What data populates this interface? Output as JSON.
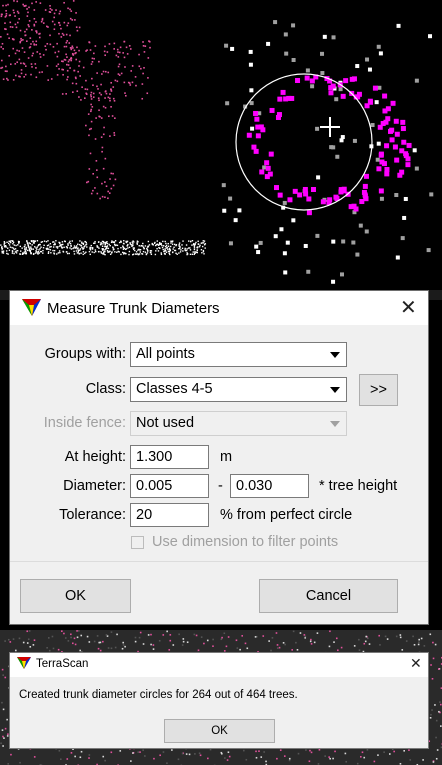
{
  "measure_dialog": {
    "title": "Measure Trunk Diameters",
    "groups_with": {
      "label": "Groups with:",
      "value": "All points"
    },
    "class": {
      "label": "Class:",
      "value": "Classes 4-5",
      "more_button": ">>"
    },
    "inside_fence": {
      "label": "Inside fence:",
      "value": "Not used"
    },
    "at_height": {
      "label": "At height:",
      "value": "1.300",
      "unit": "m"
    },
    "diameter": {
      "label": "Diameter:",
      "min": "0.005",
      "dash": "-",
      "max": "0.030",
      "unit": "* tree height"
    },
    "tolerance": {
      "label": "Tolerance:",
      "value": "20",
      "unit": "% from perfect circle"
    },
    "use_dimension": {
      "label": "Use dimension to filter points",
      "checked": false
    },
    "ok_label": "OK",
    "cancel_label": "Cancel"
  },
  "terrascan_dialog": {
    "title": "TerraScan",
    "message": "Created trunk diameter circles for 264 out of 464 trees.",
    "ok_label": "OK"
  },
  "colors": {
    "magenta_points": "#ff00ff",
    "pink_points": "#e0509b",
    "white_points": "#ffffff",
    "gray_points": "#a0a0a0"
  }
}
